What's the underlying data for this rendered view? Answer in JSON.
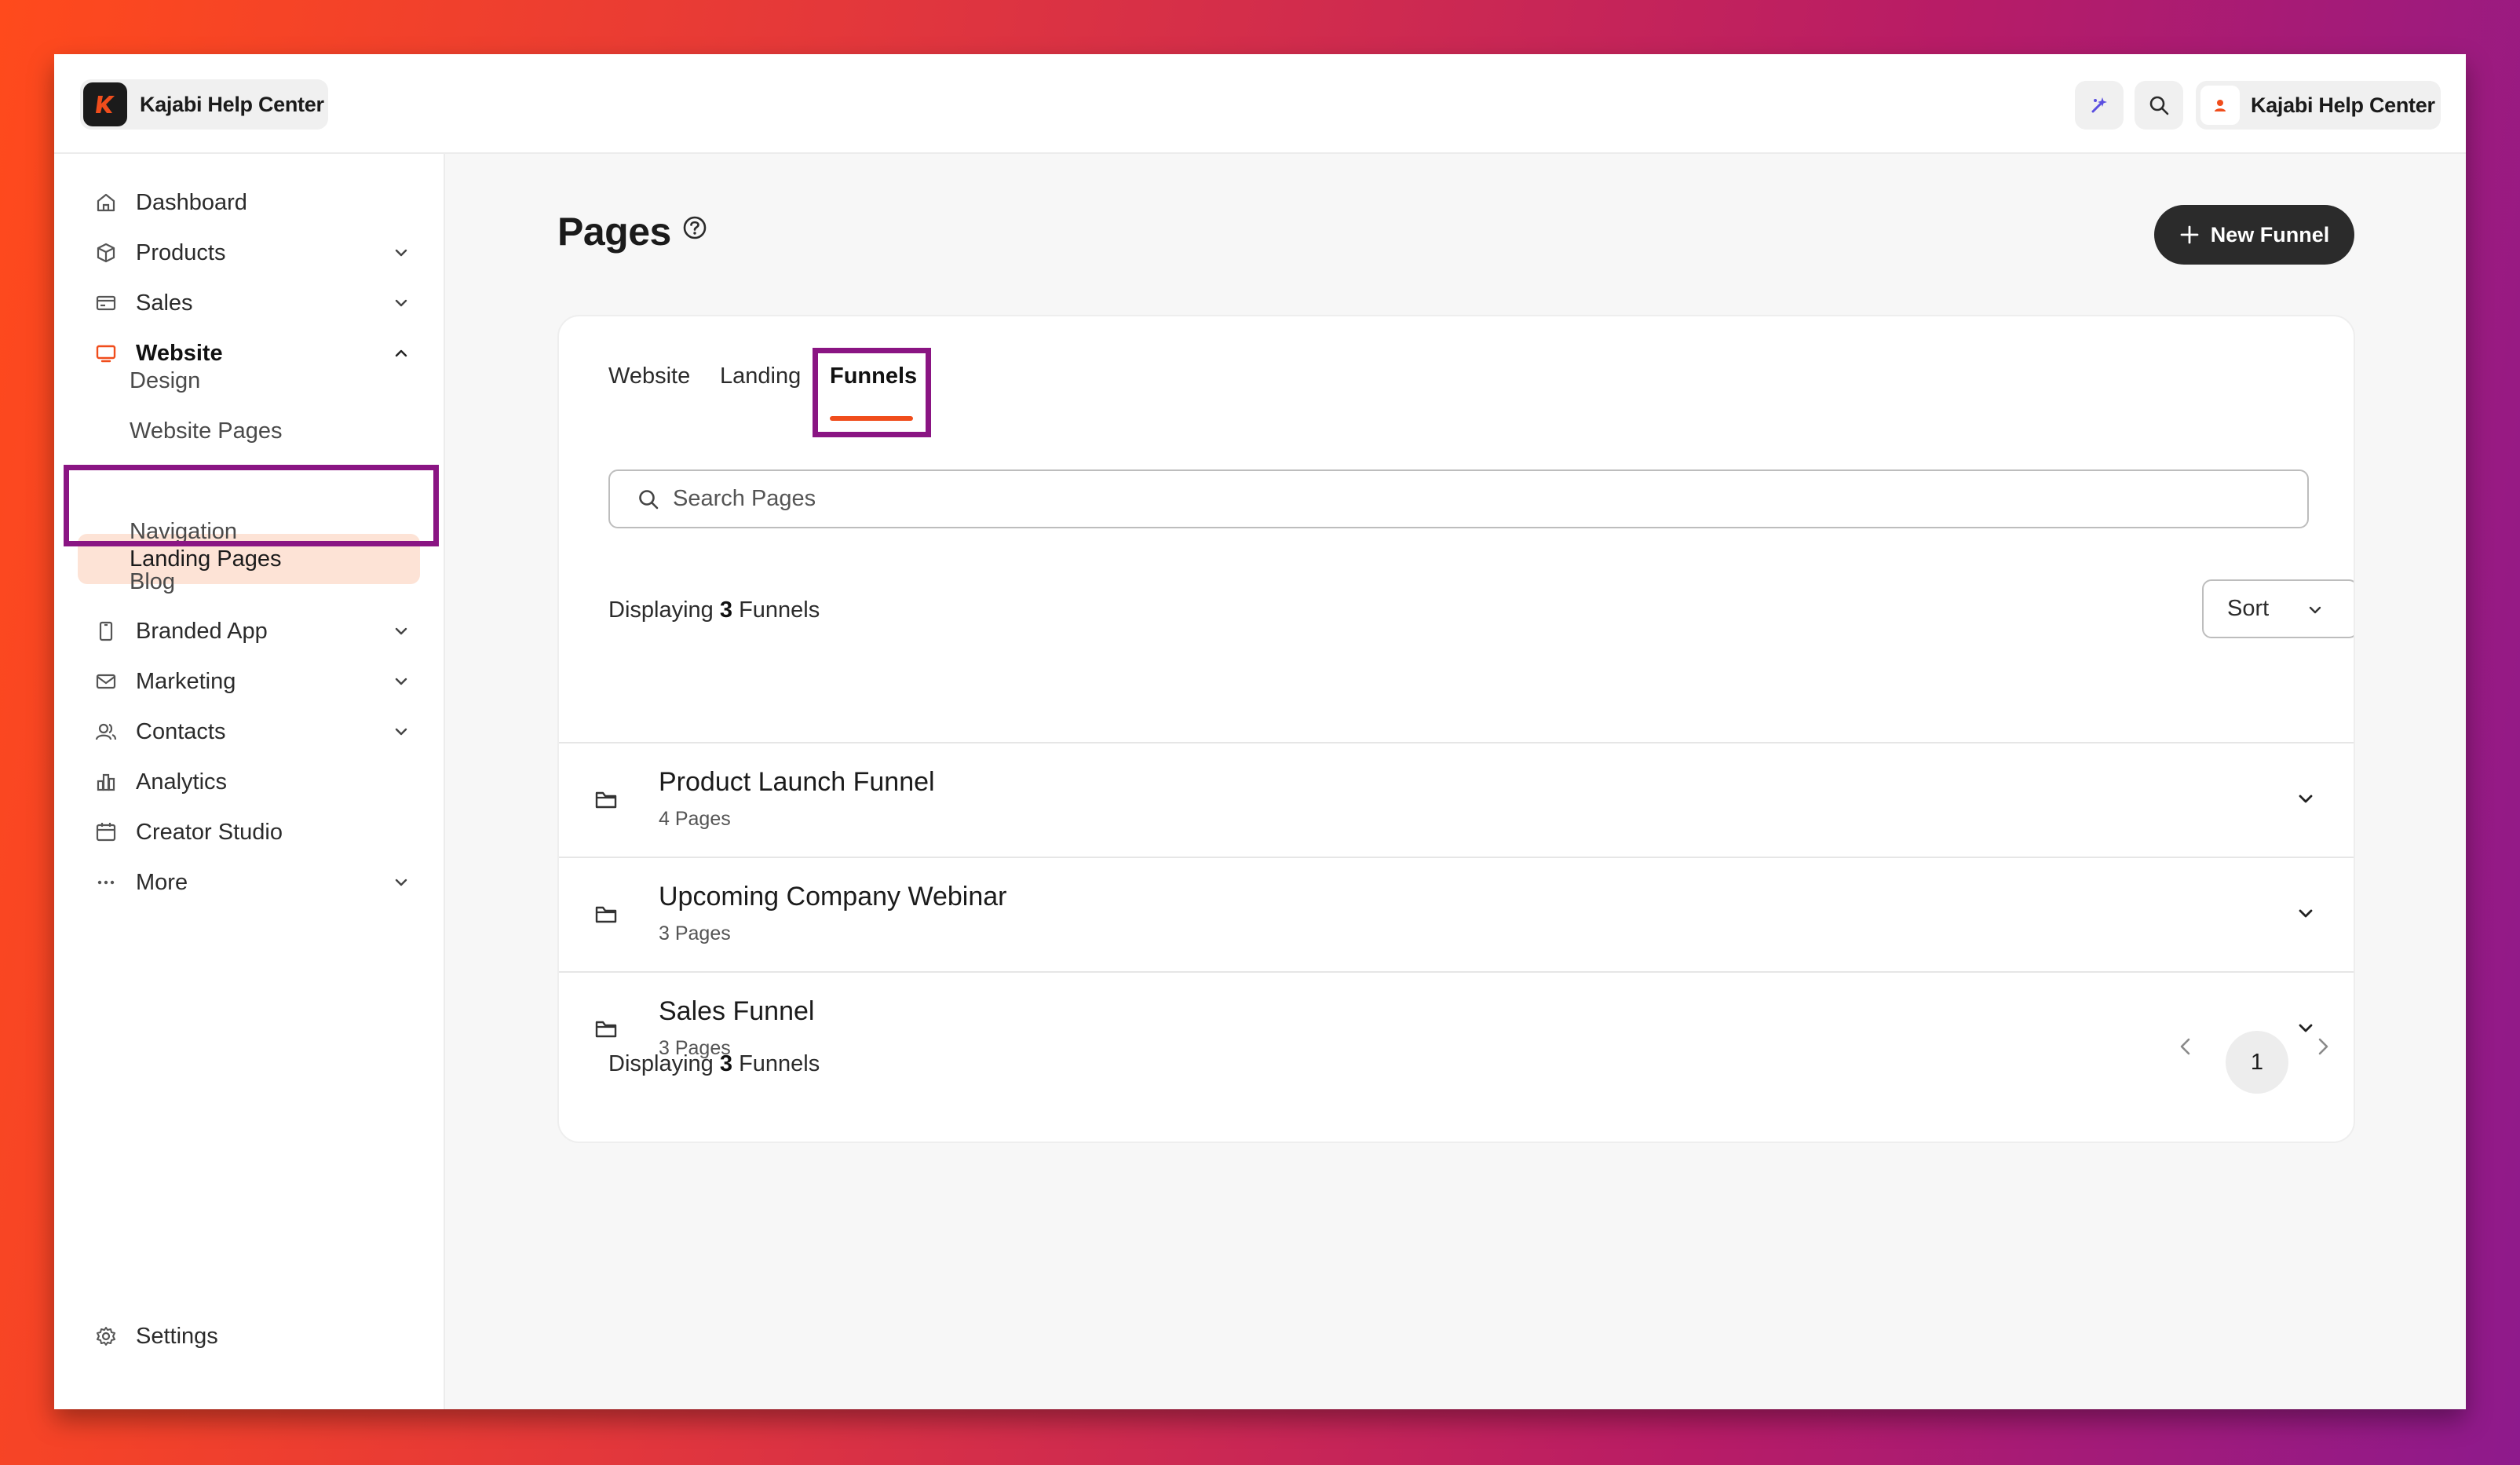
{
  "header": {
    "brand_name": "Kajabi Help Center",
    "account_name": "Kajabi Help Center",
    "brand_color": "#f04d1c"
  },
  "sidebar": {
    "items": [
      {
        "label": "Dashboard",
        "icon": "home-icon"
      },
      {
        "label": "Products",
        "icon": "box-icon"
      },
      {
        "label": "Sales",
        "icon": "credit-card-icon"
      },
      {
        "label": "Website",
        "icon": "monitor-icon"
      },
      {
        "label": "Branded App",
        "icon": "phone-icon"
      },
      {
        "label": "Marketing",
        "icon": "mail-icon"
      },
      {
        "label": "Contacts",
        "icon": "users-icon"
      },
      {
        "label": "Analytics",
        "icon": "bar-chart-icon"
      },
      {
        "label": "Creator Studio",
        "icon": "calendar-icon"
      },
      {
        "label": "More",
        "icon": "dots-icon"
      }
    ],
    "website_sub": [
      "Design",
      "Website Pages",
      "Landing Pages",
      "Navigation",
      "Blog"
    ],
    "settings_label": "Settings"
  },
  "main": {
    "title": "Pages",
    "new_button": "New Funnel",
    "tabs": [
      "Website",
      "Landing",
      "Funnels"
    ],
    "active_tab": "Funnels",
    "search_placeholder": "Search Pages",
    "displaying_prefix": "Displaying",
    "displaying_count": "3",
    "displaying_suffix": "Funnels",
    "sort_label": "Sort",
    "funnels": [
      {
        "title": "Product Launch Funnel",
        "pages": "4 Pages"
      },
      {
        "title": "Upcoming Company Webinar",
        "pages": "3 Pages"
      },
      {
        "title": "Sales Funnel",
        "pages": "3 Pages"
      }
    ],
    "current_page": "1"
  }
}
